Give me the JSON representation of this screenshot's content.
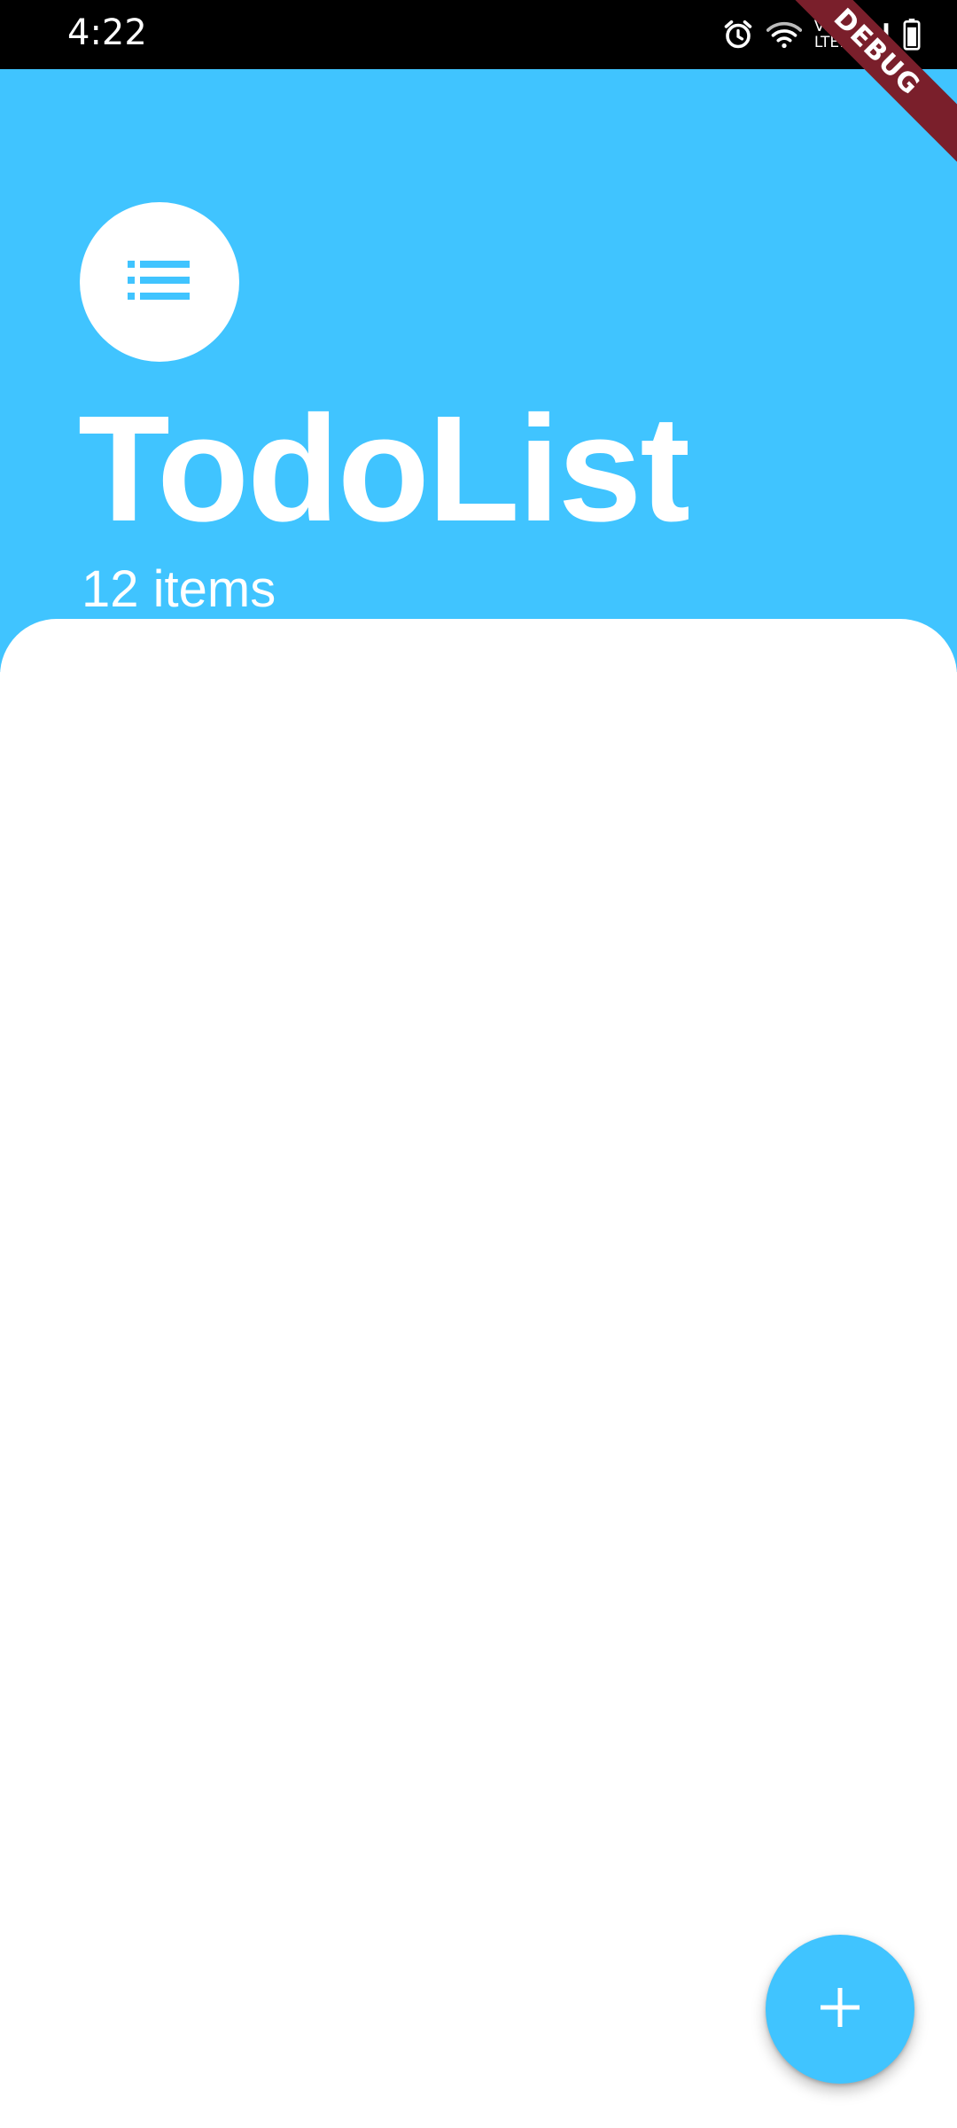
{
  "status_bar": {
    "time": "4:22",
    "network_line1": "Vo))",
    "network_line2": "LTE1",
    "icons": [
      "alarm-icon",
      "wifi-icon",
      "signal-icon",
      "battery-icon"
    ]
  },
  "debug_banner": {
    "label": "DEBUG"
  },
  "header": {
    "icon": "list-icon",
    "title": "TodoList",
    "count_label": "12 items"
  },
  "fab": {
    "icon": "plus-icon"
  },
  "colors": {
    "accent": "#40c4ff",
    "status_bar_bg": "#000000",
    "debug_banner_bg": "#7a1f2b",
    "background": "#ffffff"
  }
}
